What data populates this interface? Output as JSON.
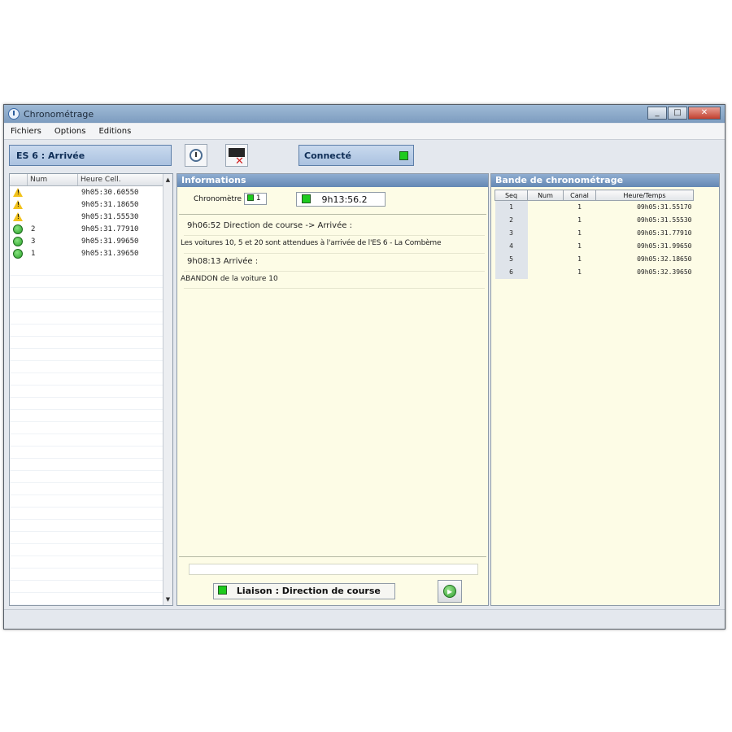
{
  "window": {
    "title": "Chronométrage"
  },
  "window_buttons": {
    "minimize": "_",
    "maximize": "□",
    "close": "✕"
  },
  "menu": {
    "items": [
      "Fichiers",
      "Options",
      "Editions"
    ]
  },
  "toolbar": {
    "station": "ES 6 : Arrivée",
    "connection_status": "Connecté",
    "icons": [
      "clock-icon",
      "cancel-icon"
    ]
  },
  "left_list": {
    "columns": [
      "",
      "Num",
      "Heure Cell."
    ],
    "rows": [
      {
        "icon": "warning",
        "num": "",
        "time": "9h05:30.60550"
      },
      {
        "icon": "warning",
        "num": "",
        "time": "9h05:31.18650"
      },
      {
        "icon": "warning",
        "num": "",
        "time": "9h05:31.55530"
      },
      {
        "icon": "ok",
        "num": "2",
        "time": "9h05:31.77910"
      },
      {
        "icon": "ok",
        "num": "3",
        "time": "9h05:31.99650"
      },
      {
        "icon": "ok",
        "num": "1",
        "time": "9h05:31.39650"
      }
    ]
  },
  "informations": {
    "title": "Informations",
    "chrono_label": "Chronomètre",
    "chrono_value": "1",
    "current_time": "9h13:56.2",
    "messages": [
      "9h06:52 Direction de course -> Arrivée :",
      "Les voitures 10, 5 et 20 sont attendues à l'arrivée de l'ES 6 - La Combème",
      "9h08:13 Arrivée :",
      "ABANDON de la voiture 10"
    ],
    "link_status": "Liaison : Direction de course"
  },
  "bande": {
    "title": "Bande de chronométrage",
    "columns": [
      "Seq",
      "Num",
      "Canal",
      "Heure/Temps"
    ],
    "rows": [
      {
        "seq": "1",
        "num": "",
        "canal": "1",
        "time": "09h05:31.55170"
      },
      {
        "seq": "2",
        "num": "",
        "canal": "1",
        "time": "09h05:31.55530"
      },
      {
        "seq": "3",
        "num": "",
        "canal": "1",
        "time": "09h05:31.77910"
      },
      {
        "seq": "4",
        "num": "",
        "canal": "1",
        "time": "09h05:31.99650"
      },
      {
        "seq": "5",
        "num": "",
        "canal": "1",
        "time": "09h05:32.18650"
      },
      {
        "seq": "6",
        "num": "",
        "canal": "1",
        "time": "09h05:32.39650"
      }
    ]
  }
}
